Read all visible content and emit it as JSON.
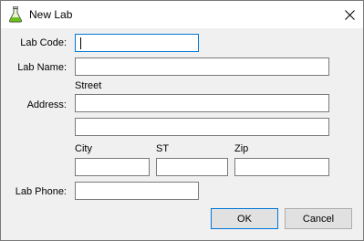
{
  "window": {
    "title": "New Lab",
    "close_icon": "close-icon",
    "app_icon": "flask-icon"
  },
  "form": {
    "lab_code": {
      "label": "Lab Code:",
      "value": ""
    },
    "lab_name": {
      "label": "Lab Name:",
      "value": ""
    },
    "address": {
      "label": "Address:",
      "street_caption": "Street",
      "street1": "",
      "street2": ""
    },
    "city": {
      "label": "City",
      "value": ""
    },
    "state": {
      "label": "ST",
      "value": ""
    },
    "zip": {
      "label": "Zip",
      "value": ""
    },
    "lab_phone": {
      "label": "Lab Phone:",
      "value": ""
    }
  },
  "buttons": {
    "ok": "OK",
    "cancel": "Cancel"
  },
  "colors": {
    "accent": "#0078d7",
    "title_bg": "#ffffff",
    "dialog_bg": "#f0f0f0"
  }
}
